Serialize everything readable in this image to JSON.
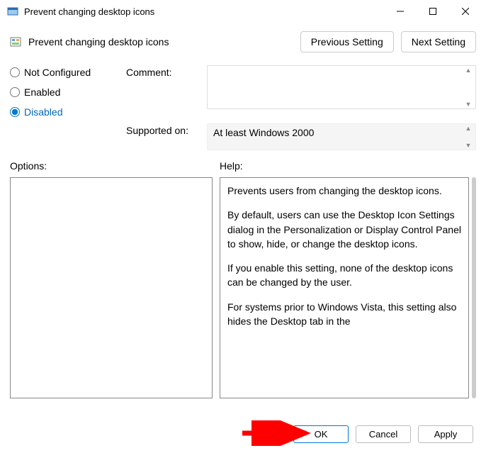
{
  "window": {
    "title": "Prevent changing desktop icons"
  },
  "policy": {
    "title": "Prevent changing desktop icons"
  },
  "nav": {
    "prev": "Previous Setting",
    "next": "Next Setting"
  },
  "state": {
    "not_configured": "Not Configured",
    "enabled": "Enabled",
    "disabled": "Disabled",
    "selected": "disabled"
  },
  "labels": {
    "comment": "Comment:",
    "supported": "Supported on:",
    "options": "Options:",
    "help": "Help:"
  },
  "supported_value": "At least Windows 2000",
  "help_text": {
    "p1": "Prevents users from changing the desktop icons.",
    "p2": "By default, users can use the Desktop Icon Settings dialog in the Personalization or Display Control Panel to show, hide, or change the desktop icons.",
    "p3": "If you enable this setting, none of the desktop icons can be changed by the user.",
    "p4": "For systems prior to Windows Vista, this setting also hides the Desktop tab in the"
  },
  "footer": {
    "ok": "OK",
    "cancel": "Cancel",
    "apply": "Apply"
  }
}
